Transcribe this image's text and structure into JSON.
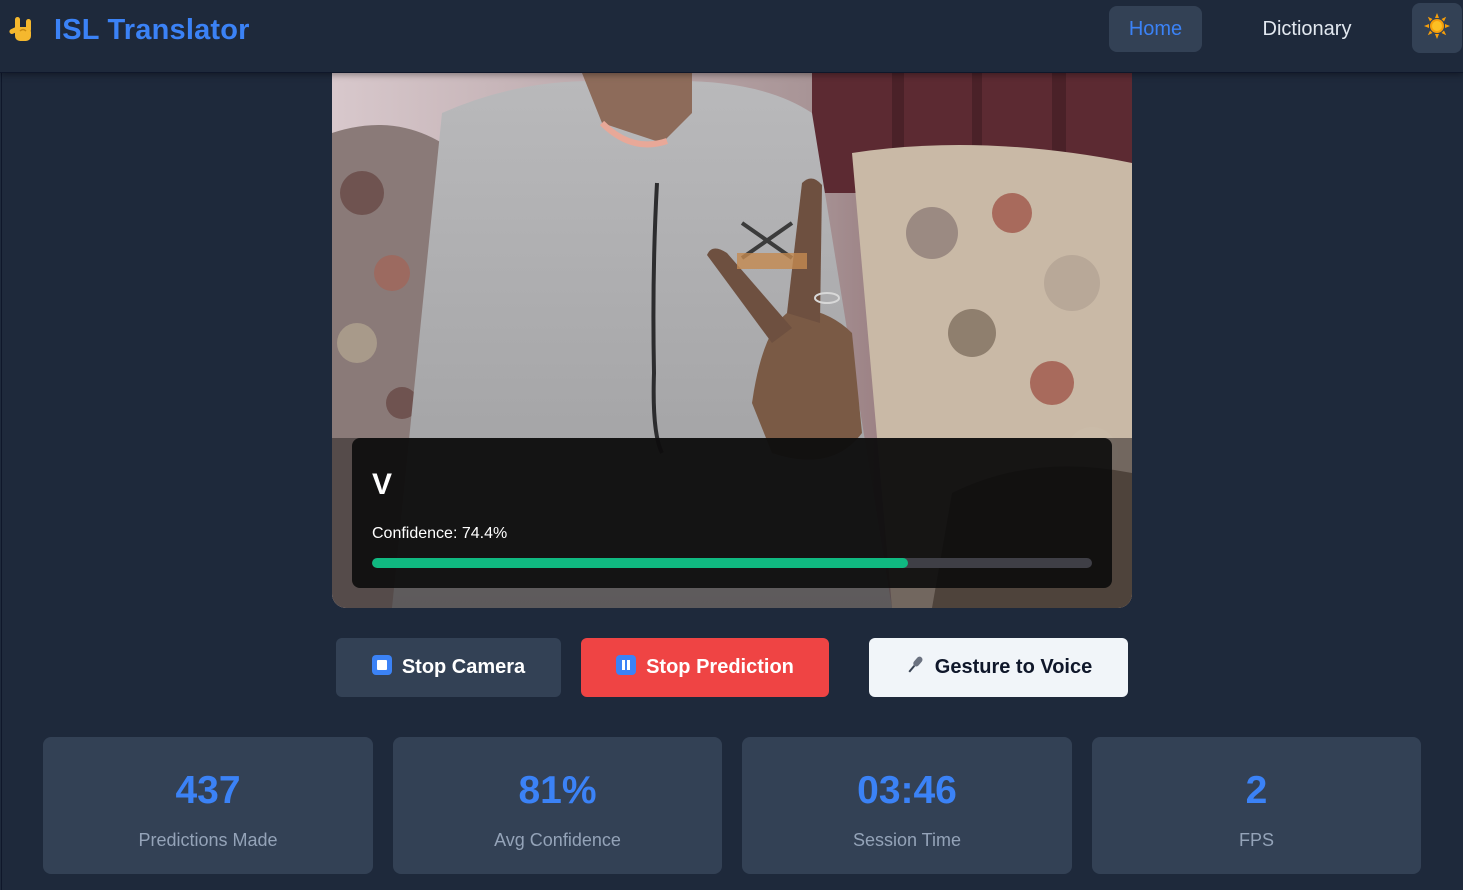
{
  "brand": {
    "title": "ISL Translator",
    "icon": "love-you-hand-sign-icon"
  },
  "nav": {
    "home_label": "Home",
    "dictionary_label": "Dictionary",
    "theme_icon": "sun-icon"
  },
  "prediction": {
    "letter": "V",
    "confidence_text": "Confidence: 74.4%",
    "confidence_value": 74.4
  },
  "controls": {
    "stop_camera_label": "Stop Camera",
    "stop_prediction_label": "Stop Prediction",
    "gesture_voice_label": "Gesture to Voice"
  },
  "stats": [
    {
      "value": "437",
      "label": "Predictions Made"
    },
    {
      "value": "81%",
      "label": "Avg Confidence"
    },
    {
      "value": "03:46",
      "label": "Session Time"
    },
    {
      "value": "2",
      "label": "FPS"
    }
  ],
  "colors": {
    "accent": "#3b82f6",
    "background": "#1e293b",
    "card": "#334155",
    "danger": "#ef4444",
    "success": "#10b981"
  }
}
